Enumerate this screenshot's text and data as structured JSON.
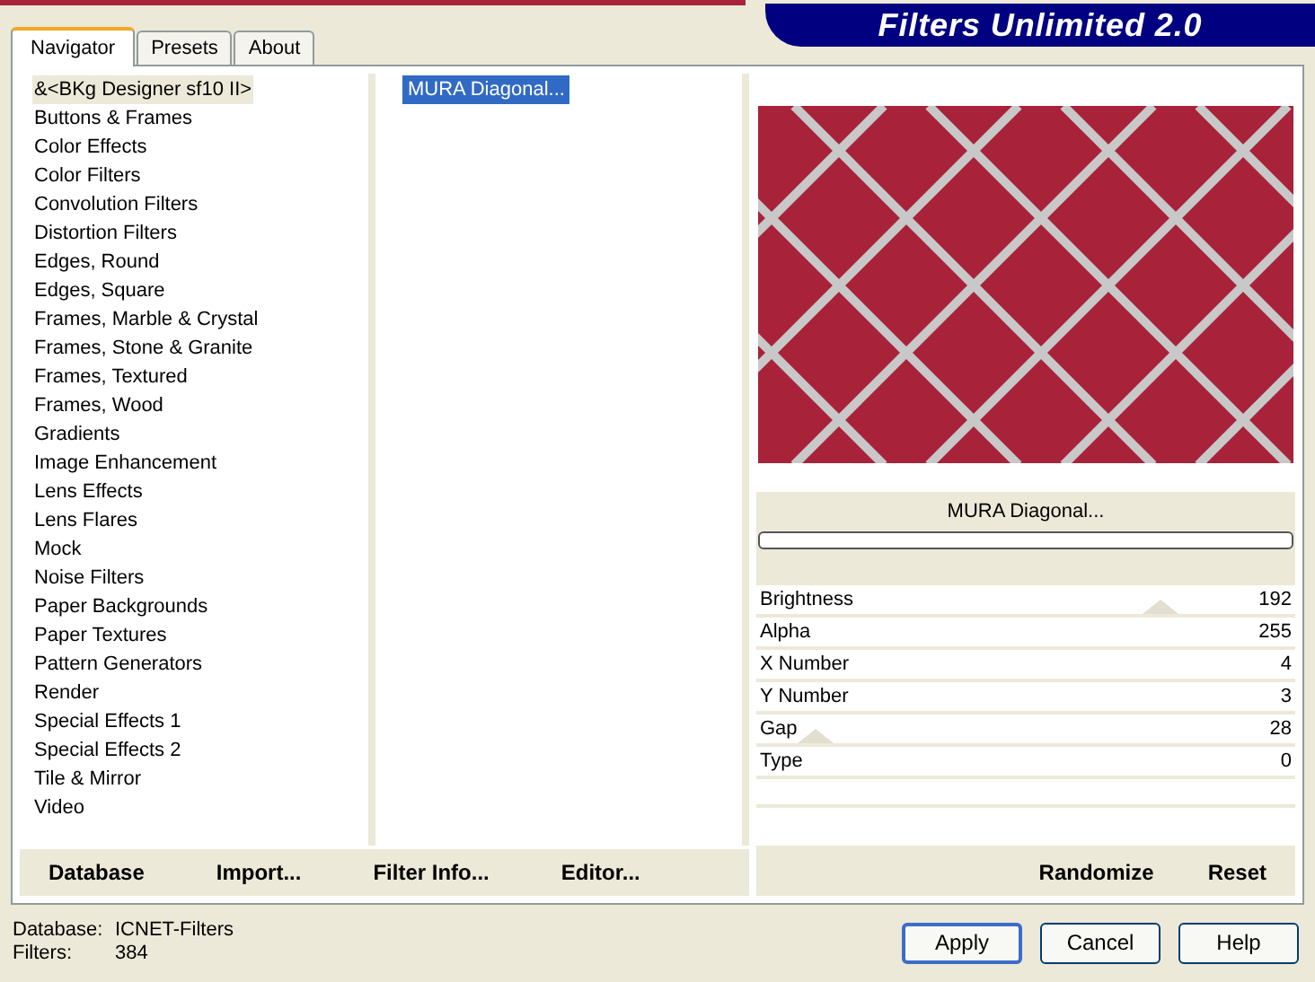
{
  "header": {
    "title": "Filters Unlimited 2.0"
  },
  "tabs": [
    {
      "label": "Navigator",
      "selected": true
    },
    {
      "label": "Presets",
      "selected": false
    },
    {
      "label": "About",
      "selected": false
    }
  ],
  "categories": [
    {
      "label": "&<BKg Designer sf10 II>",
      "selected": true
    },
    {
      "label": "Buttons & Frames",
      "selected": false
    },
    {
      "label": "Color Effects",
      "selected": false
    },
    {
      "label": "Color Filters",
      "selected": false
    },
    {
      "label": "Convolution Filters",
      "selected": false
    },
    {
      "label": "Distortion Filters",
      "selected": false
    },
    {
      "label": "Edges, Round",
      "selected": false
    },
    {
      "label": "Edges, Square",
      "selected": false
    },
    {
      "label": "Frames, Marble & Crystal",
      "selected": false
    },
    {
      "label": "Frames, Stone & Granite",
      "selected": false
    },
    {
      "label": "Frames, Textured",
      "selected": false
    },
    {
      "label": "Frames, Wood",
      "selected": false
    },
    {
      "label": "Gradients",
      "selected": false
    },
    {
      "label": "Image Enhancement",
      "selected": false
    },
    {
      "label": "Lens Effects",
      "selected": false
    },
    {
      "label": "Lens Flares",
      "selected": false
    },
    {
      "label": "Mock",
      "selected": false
    },
    {
      "label": "Noise Filters",
      "selected": false
    },
    {
      "label": "Paper Backgrounds",
      "selected": false
    },
    {
      "label": "Paper Textures",
      "selected": false
    },
    {
      "label": "Pattern Generators",
      "selected": false
    },
    {
      "label": "Render",
      "selected": false
    },
    {
      "label": "Special Effects 1",
      "selected": false
    },
    {
      "label": "Special Effects 2",
      "selected": false
    },
    {
      "label": "Tile & Mirror",
      "selected": false
    },
    {
      "label": "Video",
      "selected": false
    }
  ],
  "filters": [
    {
      "label": "MURA Diagonal...",
      "selected": true
    }
  ],
  "filter_name": "MURA Diagonal...",
  "progress": {
    "level": 0
  },
  "parameters": [
    {
      "name": "Brightness",
      "value": "192",
      "level": 0.75
    },
    {
      "name": "Alpha",
      "value": "255"
    },
    {
      "name": "X Number",
      "value": "4"
    },
    {
      "name": "Y Number",
      "value": "3"
    },
    {
      "name": "Gap",
      "value": "28",
      "level": 0.11
    },
    {
      "name": "Type",
      "value": "0"
    }
  ],
  "left_buttons": [
    "Database",
    "Import...",
    "Filter Info...",
    "Editor..."
  ],
  "right_buttons": [
    "Randomize",
    "Reset"
  ],
  "status": [
    {
      "label": "Database:",
      "value": "ICNET-Filters"
    },
    {
      "label": "Filters:",
      "value": "384"
    }
  ],
  "dialog_buttons": [
    {
      "label": "Apply",
      "default": true
    },
    {
      "label": "Cancel",
      "default": false
    },
    {
      "label": "Help",
      "default": false
    }
  ]
}
